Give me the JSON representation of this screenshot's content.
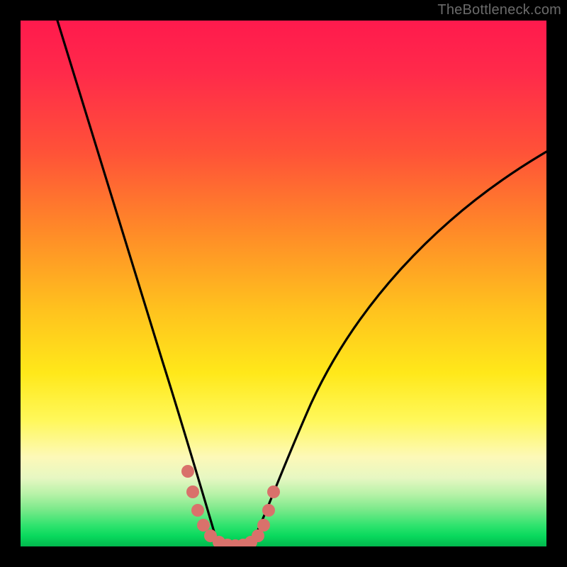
{
  "watermark": "TheBottleneck.com",
  "chart_data": {
    "type": "line",
    "title": "",
    "xlabel": "",
    "ylabel": "",
    "xlim": [
      0,
      100
    ],
    "ylim": [
      0,
      100
    ],
    "series": [
      {
        "name": "left-curve",
        "x": [
          7,
          10,
          14,
          18,
          22,
          26,
          29,
          31,
          33,
          34.5,
          36,
          37.5
        ],
        "y": [
          100,
          90,
          78,
          65,
          51,
          37,
          24,
          15,
          8,
          4,
          1.5,
          0
        ]
      },
      {
        "name": "right-curve",
        "x": [
          44,
          46,
          48,
          51,
          55,
          60,
          66,
          73,
          81,
          90,
          100
        ],
        "y": [
          0,
          1.5,
          5,
          11,
          20,
          30,
          41,
          51,
          60,
          68,
          75
        ]
      },
      {
        "name": "valley-markers",
        "points": [
          {
            "x": 31.5,
            "y": 14
          },
          {
            "x": 32.5,
            "y": 10
          },
          {
            "x": 33.5,
            "y": 6.5
          },
          {
            "x": 34.5,
            "y": 3.5
          },
          {
            "x": 36.0,
            "y": 1.5
          },
          {
            "x": 37.5,
            "y": 0.5
          },
          {
            "x": 39.0,
            "y": 0
          },
          {
            "x": 40.5,
            "y": 0
          },
          {
            "x": 42.0,
            "y": 0
          },
          {
            "x": 43.5,
            "y": 0.5
          },
          {
            "x": 45.0,
            "y": 1.5
          },
          {
            "x": 46.0,
            "y": 3.5
          },
          {
            "x": 47.0,
            "y": 6.5
          },
          {
            "x": 48.0,
            "y": 10
          }
        ]
      }
    ],
    "colors": {
      "curve": "#000000",
      "marker": "#d9716b",
      "gradient_top": "#ff1a4d",
      "gradient_mid": "#ffe81a",
      "gradient_bottom": "#02b84e"
    }
  }
}
